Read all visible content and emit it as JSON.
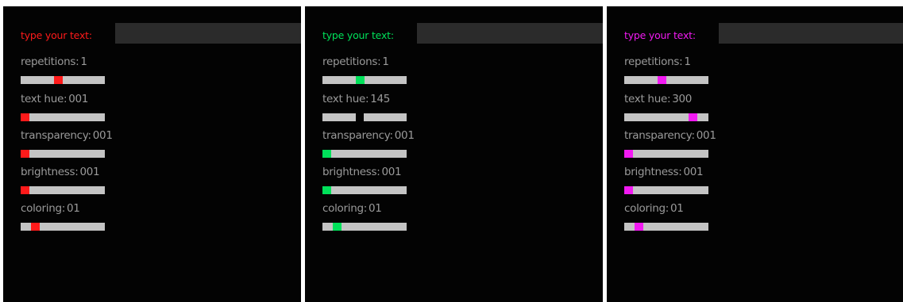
{
  "prompt_label": "type your text:",
  "label_color": "#9a9a9a",
  "track_color": "#c4c4c4",
  "panel_background": "#030303",
  "input_background": "#2b2b2b",
  "panels": [
    {
      "accent": "#ff1a1a",
      "text_input": "",
      "controls": [
        {
          "label": "repetitions:",
          "value": "1",
          "position": 0.44
        },
        {
          "label": "text hue:",
          "value": "001",
          "position": 0.0
        },
        {
          "label": "transparency:",
          "value": "001",
          "position": 0.0
        },
        {
          "label": "brightness:",
          "value": "001",
          "position": 0.0
        },
        {
          "label": "coloring:",
          "value": "01",
          "position": 0.14
        }
      ]
    },
    {
      "accent": "#00e15a",
      "text_input": "",
      "controls": [
        {
          "label": "repetitions:",
          "value": "1",
          "position": 0.44
        },
        {
          "label": "text hue:",
          "value": "145",
          "position": 0.43,
          "thumb_hidden": true
        },
        {
          "label": "transparency:",
          "value": "001",
          "position": 0.0
        },
        {
          "label": "brightness:",
          "value": "001",
          "position": 0.0
        },
        {
          "label": "coloring:",
          "value": "01",
          "position": 0.14
        }
      ]
    },
    {
      "accent": "#f21af2",
      "text_input": "",
      "controls": [
        {
          "label": "repetitions:",
          "value": "1",
          "position": 0.44
        },
        {
          "label": "text hue:",
          "value": "300",
          "position": 0.85
        },
        {
          "label": "transparency:",
          "value": "001",
          "position": 0.0
        },
        {
          "label": "brightness:",
          "value": "001",
          "position": 0.0
        },
        {
          "label": "coloring:",
          "value": "01",
          "position": 0.14
        }
      ]
    }
  ]
}
